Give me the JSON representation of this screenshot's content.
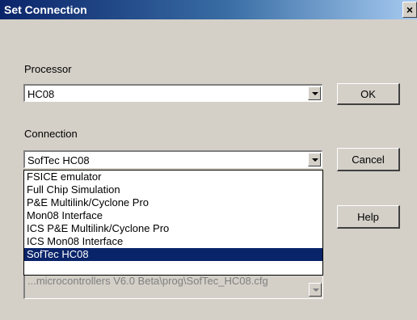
{
  "window": {
    "title": "Set Connection",
    "close_glyph": "×"
  },
  "processor": {
    "label": "Processor",
    "value": "HC08"
  },
  "connection": {
    "label": "Connection",
    "value": "SofTec HC08",
    "options": [
      "FSICE emulator",
      "Full Chip Simulation",
      "P&E Multilink/Cyclone Pro",
      "Mon08 Interface",
      "ICS P&E Multilink/Cyclone Pro",
      "ICS Mon08 Interface",
      "SofTec HC08"
    ],
    "selected_index": 6
  },
  "buttons": {
    "ok": "OK",
    "cancel": "Cancel",
    "help": "Help"
  },
  "obscured_field": {
    "partial_text": "...microcontrollers V6.0 Beta\\prog\\SofTec_HC08.cfg"
  }
}
